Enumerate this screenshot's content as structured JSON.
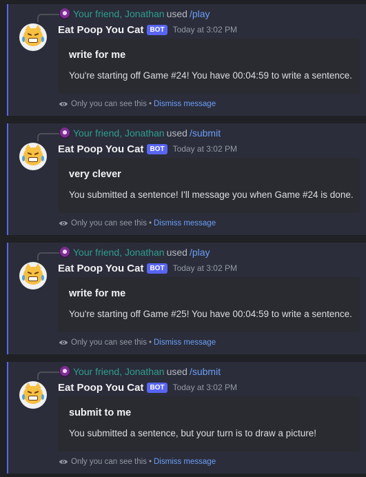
{
  "app": {
    "bot_name": "Eat Poop You Cat",
    "bot_tag": "BOT",
    "user_name": "Your friend, Jonathan",
    "used_word": "used",
    "ephemeral_text": "Only you can see this",
    "separator": "•",
    "dismiss_label": "Dismiss message"
  },
  "messages": [
    {
      "command": "/play",
      "timestamp": "Today at 3:02 PM",
      "embed_title": "write for me",
      "embed_description": "You're starting off Game #24! You have 00:04:59 to write a sentence."
    },
    {
      "command": "/submit",
      "timestamp": "Today at 3:02 PM",
      "embed_title": "very clever",
      "embed_description": "You submitted a sentence! I'll message you when Game #24 is done."
    },
    {
      "command": "/play",
      "timestamp": "Today at 3:02 PM",
      "embed_title": "write for me",
      "embed_description": "You're starting off Game #25! You have 00:04:59 to write a sentence."
    },
    {
      "command": "/submit",
      "timestamp": "Today at 3:02 PM",
      "embed_title": "submit to me",
      "embed_description": "You submitted a sentence, but your turn is to draw a picture!"
    }
  ],
  "colors": {
    "accent": "#5865f2",
    "user_name": "#2f9e8f",
    "link": "#6b9ff7"
  },
  "icons": {
    "bot_avatar": "crying-cat-emoji",
    "ephemeral": "eye-icon"
  }
}
